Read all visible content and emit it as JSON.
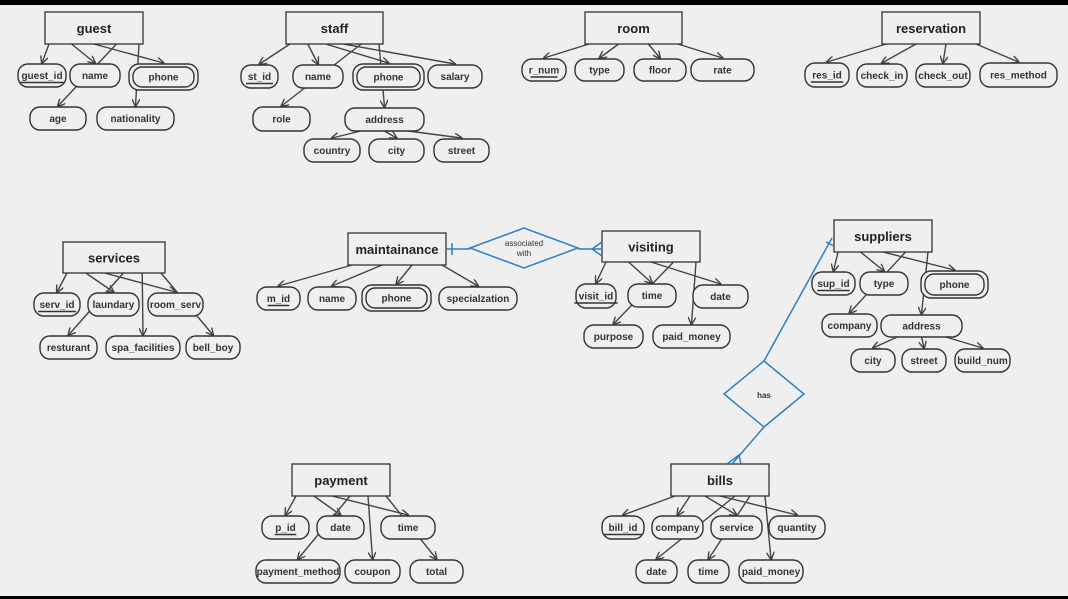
{
  "entities": [
    {
      "name": "guest",
      "attributes": [
        {
          "label": "guest_id",
          "key": true
        },
        {
          "label": "name"
        },
        {
          "label": "phone",
          "multivalued": true
        },
        {
          "label": "age"
        },
        {
          "label": "nationality"
        }
      ]
    },
    {
      "name": "staff",
      "attributes": [
        {
          "label": "st_id",
          "key": true
        },
        {
          "label": "name"
        },
        {
          "label": "phone",
          "multivalued": true
        },
        {
          "label": "salary"
        },
        {
          "label": "role"
        },
        {
          "label": "address",
          "children": [
            "country",
            "city",
            "street"
          ]
        }
      ]
    },
    {
      "name": "room",
      "attributes": [
        {
          "label": "r_num",
          "key": true
        },
        {
          "label": "type"
        },
        {
          "label": "floor"
        },
        {
          "label": "rate"
        }
      ]
    },
    {
      "name": "reservation",
      "attributes": [
        {
          "label": "res_id",
          "key": true
        },
        {
          "label": "check_in"
        },
        {
          "label": "check_out"
        },
        {
          "label": "res_method"
        }
      ]
    },
    {
      "name": "services",
      "attributes": [
        {
          "label": "serv_id",
          "key": true
        },
        {
          "label": "laundary"
        },
        {
          "label": "room_serv"
        },
        {
          "label": "resturant"
        },
        {
          "label": "spa_facilities"
        },
        {
          "label": "bell_boy"
        }
      ]
    },
    {
      "name": "maintainance",
      "attributes": [
        {
          "label": "m_id",
          "key": true
        },
        {
          "label": "name"
        },
        {
          "label": "phone",
          "multivalued": true
        },
        {
          "label": "specialzation"
        }
      ]
    },
    {
      "name": "visiting",
      "attributes": [
        {
          "label": "visit_id",
          "key": true
        },
        {
          "label": "time"
        },
        {
          "label": "date"
        },
        {
          "label": "purpose"
        },
        {
          "label": "paid_money"
        }
      ]
    },
    {
      "name": "suppliers",
      "attributes": [
        {
          "label": "sup_id",
          "key": true
        },
        {
          "label": "type"
        },
        {
          "label": "phone",
          "multivalued": true
        },
        {
          "label": "company"
        },
        {
          "label": "address",
          "children": [
            "city",
            "street",
            "build_num"
          ]
        }
      ]
    },
    {
      "name": "payment",
      "attributes": [
        {
          "label": "p_id",
          "key": true
        },
        {
          "label": "date"
        },
        {
          "label": "time"
        },
        {
          "label": "payment_method"
        },
        {
          "label": "coupon"
        },
        {
          "label": "total"
        }
      ]
    },
    {
      "name": "bills",
      "attributes": [
        {
          "label": "bill_id",
          "key": true
        },
        {
          "label": "company"
        },
        {
          "label": "service"
        },
        {
          "label": "quantity"
        },
        {
          "label": "date"
        },
        {
          "label": "time"
        },
        {
          "label": "paid_money"
        }
      ]
    }
  ],
  "relationships": [
    {
      "label_lines": [
        "associated",
        "with"
      ],
      "between": [
        "maintainance",
        "visiting"
      ],
      "cardinality": "one-to-many"
    },
    {
      "label_lines": [
        "has"
      ],
      "between": [
        "suppliers",
        "bills"
      ],
      "cardinality": "one-to-many"
    }
  ],
  "colors": {
    "relationship": "#2a7fc9",
    "background": "#efefef",
    "stroke": "#333333"
  }
}
